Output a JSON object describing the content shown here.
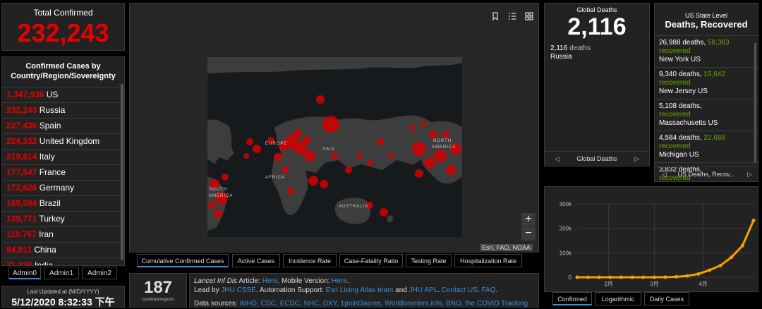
{
  "total": {
    "label": "Total Confirmed",
    "value": "232,243"
  },
  "country_list": {
    "title": "Confirmed Cases by Country/Region/Sovereignty",
    "rows": [
      {
        "value": "1,347,936",
        "name": "US"
      },
      {
        "value": "232,243",
        "name": "Russia"
      },
      {
        "value": "227,436",
        "name": "Spain"
      },
      {
        "value": "224,332",
        "name": "United Kingdom"
      },
      {
        "value": "219,814",
        "name": "Italy"
      },
      {
        "value": "177,547",
        "name": "France"
      },
      {
        "value": "172,626",
        "name": "Germany"
      },
      {
        "value": "169,594",
        "name": "Brazil"
      },
      {
        "value": "139,771",
        "name": "Turkey"
      },
      {
        "value": "110,767",
        "name": "Iran"
      },
      {
        "value": "84,011",
        "name": "China"
      },
      {
        "value": "71,339",
        "name": "India"
      }
    ]
  },
  "admin_tabs": [
    "Admin0",
    "Admin1",
    "Admin2"
  ],
  "updated": {
    "label": "Last Updated at (M/D/YYYY)",
    "value": "5/12/2020 8:32:33 下午"
  },
  "map": {
    "labels": [
      "EUROPE",
      "ASIA",
      "AFRICA",
      "NORTH",
      "AMERICA",
      "SOUTH",
      "AMERICA",
      "AUSTRALIA"
    ],
    "attribution": "Esri, FAO, NOAA",
    "zoom_in": "+",
    "zoom_out": "−",
    "tabs": [
      "Cumulative Confirmed Cases",
      "Active Cases",
      "Incidence Rate",
      "Case-Fatality Ratio",
      "Testing Rate",
      "Hospitalization Rate"
    ]
  },
  "count": {
    "value": "187",
    "label": "countries/regions"
  },
  "info": {
    "line1_prefix": "Lancet Inf Dis",
    "line1_text": " Article: ",
    "here1": "Here",
    "mobile": ". Mobile Version: ",
    "here2": "Here",
    "line2_lead": "Lead by ",
    "jhu_csse": "JHU CSSE",
    "automation": ". Automation Support: ",
    "esri": "Esri Living Atlas team",
    "and": " and ",
    "jhu_apl": "JHU APL",
    "contact": "Contact US",
    "faq": "FAQ",
    "line3_prefix": "Data sources: ",
    "sources": "WHO, CDC, ECDC, NHC, DXY, 1point3acres, Worldometers.info, BNO, the COVID Tracking"
  },
  "global_deaths": {
    "label": "Global Deaths",
    "value": "2,116",
    "sub_value": "2,116",
    "sub_unit": "deaths",
    "sub_place": "Russia",
    "footer": "Global Deaths"
  },
  "us_state": {
    "label1": "US State Level",
    "label2": "Deaths, Recovered",
    "items": [
      {
        "deaths": "26,988",
        "recovered": "58,363",
        "place": "New York US"
      },
      {
        "deaths": "9,340",
        "recovered": "15,642",
        "place": "New Jersey US"
      },
      {
        "deaths": "5,108",
        "recovered": "",
        "place": "Massachusetts US"
      },
      {
        "deaths": "4,584",
        "recovered": "22,686",
        "place": "Michigan US"
      },
      {
        "deaths": "3,832",
        "recovered": "",
        "place": ""
      }
    ],
    "deaths_word": "deaths,",
    "recovered_word": "recovered",
    "footer": "US Deaths, Recov..."
  },
  "chart_tabs": [
    "Confirmed",
    "Logarithmic",
    "Daily Cases"
  ],
  "colors": {
    "accent": "#3b8fd6",
    "confirmed_red": "#e60000",
    "recovered_green": "#70a800",
    "line_orange": "#f5a000"
  },
  "chart_data": {
    "type": "line",
    "yticks": [
      "0",
      "100k",
      "200k",
      "300k"
    ],
    "ylim": [
      0,
      300000
    ],
    "xticks": [
      "2月",
      "3月",
      "4月"
    ],
    "series": [
      {
        "x_days": [
          0,
          7,
          14,
          21,
          28,
          35,
          42,
          49,
          56,
          63,
          70,
          77,
          84,
          91,
          98,
          105,
          112
        ],
        "values": [
          0,
          0,
          0,
          0,
          0,
          0,
          0,
          30,
          500,
          1800,
          5400,
          13500,
          29000,
          48000,
          82000,
          129000,
          232243
        ]
      }
    ]
  }
}
